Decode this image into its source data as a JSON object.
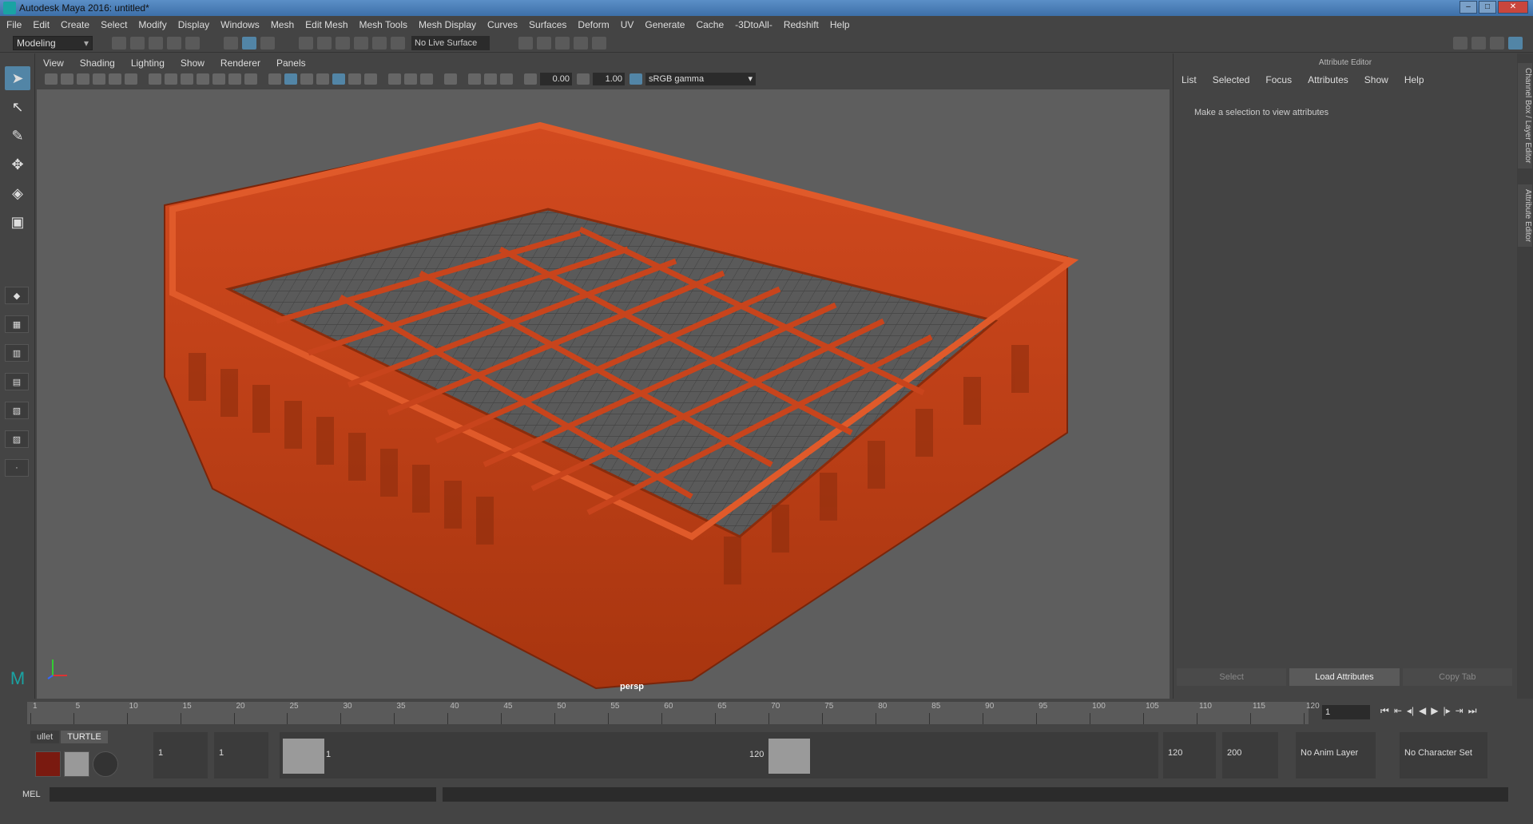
{
  "window": {
    "title": "Autodesk Maya 2016: untitled*",
    "buttons": [
      "–",
      "□",
      "✕"
    ]
  },
  "menubar": [
    "File",
    "Edit",
    "Create",
    "Select",
    "Modify",
    "Display",
    "Windows",
    "Mesh",
    "Edit Mesh",
    "Mesh Tools",
    "Mesh Display",
    "Curves",
    "Surfaces",
    "Deform",
    "UV",
    "Generate",
    "Cache",
    "-3DtoAll-",
    "Redshift",
    "Help"
  ],
  "shelf": {
    "mode": "Modeling",
    "live_surface": "No Live Surface"
  },
  "viewport": {
    "menu": [
      "View",
      "Shading",
      "Lighting",
      "Show",
      "Renderer",
      "Panels"
    ],
    "exposure": "0.00",
    "gamma": "1.00",
    "color_space": "sRGB gamma",
    "camera_label": "persp",
    "background": "#5e5e5e",
    "object_color": "#c8441c"
  },
  "attribute_editor": {
    "header": "Attribute Editor",
    "menu": [
      "List",
      "Selected",
      "Focus",
      "Attributes",
      "Show",
      "Help"
    ],
    "message": "Make a selection to view attributes",
    "buttons": [
      "Select",
      "Load Attributes",
      "Copy Tab"
    ]
  },
  "side_tabs": [
    "Channel Box / Layer Editor",
    "Attribute Editor"
  ],
  "timeline": {
    "ticks": [
      "1",
      "5",
      "10",
      "15",
      "20",
      "25",
      "30",
      "35",
      "40",
      "45",
      "50",
      "55",
      "60",
      "65",
      "70",
      "75",
      "80",
      "85",
      "90",
      "95",
      "100",
      "105",
      "110",
      "115",
      "120"
    ],
    "current_frame": "1",
    "controls": [
      "⏮",
      "⇤",
      "◂|",
      "◀",
      "▶",
      "|▸",
      "⇥",
      "⏭"
    ]
  },
  "range": {
    "shelf_tabs": [
      "ullet",
      "TURTLE"
    ],
    "start": "1",
    "playback_start": "1",
    "handle_start": "1",
    "handle_end": "120",
    "playback_end": "120",
    "end": "200",
    "anim_layer": "No Anim Layer",
    "character_set": "No Character Set"
  },
  "command_line": {
    "label": "MEL"
  }
}
